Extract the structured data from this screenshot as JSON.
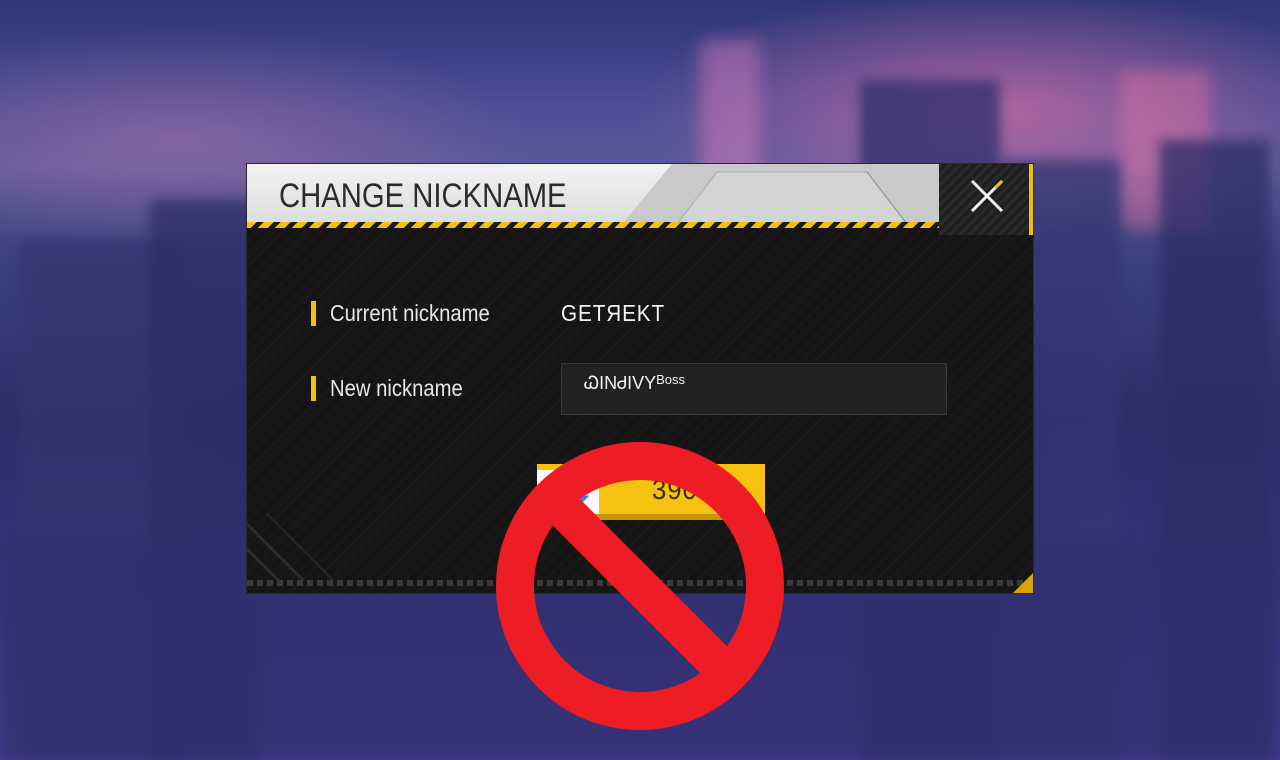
{
  "dialog": {
    "title": "CHANGE NICKNAME",
    "close_icon": "close-x-icon",
    "current_label": "Current nickname",
    "current_value": "GETЯEKT",
    "new_label": "New nickname",
    "new_value_main": "ᏇINᏧIVY",
    "new_value_suffix": "Boss",
    "price": "390",
    "price_icon": "diamond-icon"
  },
  "overlay": {
    "icon": "prohibited-icon",
    "color": "#ee1c25"
  },
  "colors": {
    "accent": "#f4c00f",
    "panel": "#151515",
    "header": "#e6e6e6"
  }
}
